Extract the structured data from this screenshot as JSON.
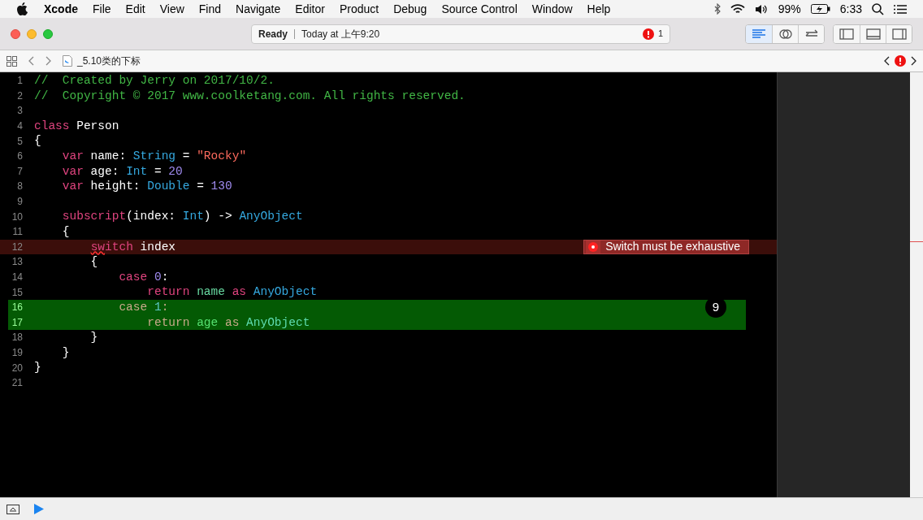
{
  "menu_bar": {
    "app": "Xcode",
    "menus": [
      "File",
      "Edit",
      "View",
      "Find",
      "Navigate",
      "Editor",
      "Product",
      "Debug",
      "Source Control",
      "Window",
      "Help"
    ],
    "battery": "99%",
    "time": "6:33"
  },
  "toolbar": {
    "status": "Ready",
    "activity": "Today at 上午9:20",
    "issue_count": "1",
    "editor_modes": [
      {
        "kind": "standard",
        "selected": true
      },
      {
        "kind": "assistant",
        "selected": false
      },
      {
        "kind": "version",
        "selected": false
      }
    ],
    "panels": [
      {
        "kind": "navigator",
        "on": false
      },
      {
        "kind": "debug",
        "on": false
      },
      {
        "kind": "utilities",
        "on": false
      }
    ]
  },
  "jump_bar": {
    "file": "_5.10类的下标"
  },
  "editor": {
    "lines": [
      {
        "number": "1",
        "kind": "normal",
        "tokens": [
          {
            "kind": "comment",
            "text": "//  Created by Jerry on 2017/10/2."
          }
        ]
      },
      {
        "number": "2",
        "kind": "normal",
        "tokens": [
          {
            "kind": "comment",
            "text": "//  Copyright © 2017 www.coolketang.com. All rights reserved."
          }
        ]
      },
      {
        "number": "3",
        "kind": "normal"
      },
      {
        "number": "4",
        "kind": "normal",
        "tokens": [
          {
            "kind": "keyword",
            "text": "class"
          },
          {
            "kind": "plain",
            "text": " Person"
          }
        ]
      },
      {
        "number": "5",
        "kind": "normal",
        "tokens": [
          {
            "kind": "plain",
            "text": "{"
          }
        ]
      },
      {
        "number": "6",
        "kind": "normal",
        "tokens": [
          {
            "kind": "keyword",
            "text": "    var"
          },
          {
            "kind": "plain",
            "text": " name: "
          },
          {
            "kind": "type",
            "text": "String"
          },
          {
            "kind": "plain",
            "text": " = "
          },
          {
            "kind": "string",
            "text": "\"Rocky\""
          }
        ]
      },
      {
        "number": "7",
        "kind": "normal",
        "tokens": [
          {
            "kind": "keyword",
            "text": "    var"
          },
          {
            "kind": "plain",
            "text": " age: "
          },
          {
            "kind": "type",
            "text": "Int"
          },
          {
            "kind": "plain",
            "text": " = "
          },
          {
            "kind": "number",
            "text": "20"
          }
        ]
      },
      {
        "number": "8",
        "kind": "normal",
        "tokens": [
          {
            "kind": "keyword",
            "text": "    var"
          },
          {
            "kind": "plain",
            "text": " height: "
          },
          {
            "kind": "type",
            "text": "Double"
          },
          {
            "kind": "plain",
            "text": " = "
          },
          {
            "kind": "number",
            "text": "130"
          }
        ]
      },
      {
        "number": "9",
        "kind": "normal"
      },
      {
        "number": "10",
        "kind": "normal",
        "tokens": [
          {
            "kind": "keyword",
            "text": "    subscript"
          },
          {
            "kind": "plain",
            "text": "(index: "
          },
          {
            "kind": "type",
            "text": "Int"
          },
          {
            "kind": "plain",
            "text": ") -> "
          },
          {
            "kind": "type",
            "text": "AnyObject"
          }
        ]
      },
      {
        "number": "11",
        "kind": "normal",
        "tokens": [
          {
            "kind": "plain",
            "text": "    {"
          }
        ]
      },
      {
        "number": "12",
        "kind": "error",
        "error": "Switch must be exhaustive",
        "tokens": [
          {
            "kind": "keyword",
            "text": "        sw",
            "underlined": true
          },
          {
            "kind": "keyword",
            "text": "itch"
          },
          {
            "kind": "plain",
            "text": " index"
          }
        ]
      },
      {
        "number": "13",
        "kind": "normal",
        "tokens": [
          {
            "kind": "plain",
            "text": "        {"
          }
        ]
      },
      {
        "number": "14",
        "kind": "normal",
        "tokens": [
          {
            "kind": "keyword",
            "text": "            case"
          },
          {
            "kind": "number",
            "text": " 0"
          },
          {
            "kind": "plain",
            "text": ":"
          }
        ]
      },
      {
        "number": "15",
        "kind": "normal",
        "tokens": [
          {
            "kind": "keyword",
            "text": "                return"
          },
          {
            "kind": "property",
            "text": " name"
          },
          {
            "kind": "keyword",
            "text": " as"
          },
          {
            "kind": "type",
            "text": " AnyObject"
          }
        ]
      },
      {
        "number": "16",
        "kind": "changed",
        "badge": "9",
        "tokens": [
          {
            "kind": "keyword",
            "text": "            case"
          },
          {
            "kind": "number",
            "text": " 1"
          },
          {
            "kind": "plain",
            "text": ":"
          }
        ]
      },
      {
        "number": "17",
        "kind": "changed",
        "tokens": [
          {
            "kind": "keyword",
            "text": "                return"
          },
          {
            "kind": "property",
            "text": " age"
          },
          {
            "kind": "keyword",
            "text": " as"
          },
          {
            "kind": "type",
            "text": " AnyObject"
          }
        ]
      },
      {
        "number": "18",
        "kind": "normal",
        "tokens": [
          {
            "kind": "plain",
            "text": "        }"
          }
        ]
      },
      {
        "number": "19",
        "kind": "normal",
        "tokens": [
          {
            "kind": "plain",
            "text": "    }"
          }
        ]
      },
      {
        "number": "20",
        "kind": "normal",
        "tokens": [
          {
            "kind": "plain",
            "text": "}"
          }
        ]
      },
      {
        "number": "21",
        "kind": "normal"
      }
    ]
  }
}
